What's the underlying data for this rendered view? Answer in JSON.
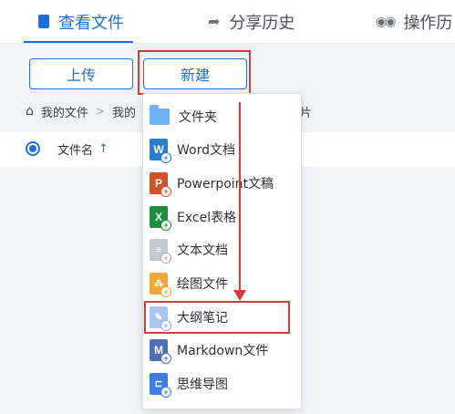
{
  "tabs": [
    {
      "label": "查看文件",
      "icon": "document-icon",
      "active": true
    },
    {
      "label": "分享历史",
      "icon": "share-icon",
      "active": false
    },
    {
      "label": "操作历",
      "icon": "glasses-icon",
      "active": false
    }
  ],
  "toolbar": {
    "upload_label": "上传",
    "new_label": "新建"
  },
  "breadcrumb": {
    "home_icon": "home-icon",
    "items": [
      "我的文件",
      "我的",
      "片"
    ]
  },
  "list": {
    "name_column": "文件名",
    "sort_arrow": "↑"
  },
  "new_menu": {
    "items": [
      {
        "label": "文件夹",
        "icon": "folder-icon",
        "color": "#6fb3f5",
        "letter": ""
      },
      {
        "label": "Word文档",
        "icon": "word-icon",
        "color": "#2b7cd3",
        "letter": "W"
      },
      {
        "label": "Powerpoint文稿",
        "icon": "powerpoint-icon",
        "color": "#d0522a",
        "letter": "P"
      },
      {
        "label": "Excel表格",
        "icon": "excel-icon",
        "color": "#1e8e3e",
        "letter": "X"
      },
      {
        "label": "文本文档",
        "icon": "text-file-icon",
        "color": "#c4c8cf",
        "letter": ""
      },
      {
        "label": "绘图文件",
        "icon": "drawing-icon",
        "color": "#f3a73a",
        "letter": ""
      },
      {
        "label": "大纲笔记",
        "icon": "outline-note-icon",
        "color": "#a9c6f0",
        "letter": ""
      },
      {
        "label": "Markdown文件",
        "icon": "markdown-icon",
        "color": "#4f6fb8",
        "letter": "M"
      },
      {
        "label": "思维导图",
        "icon": "mindmap-icon",
        "color": "#3f7be6",
        "letter": ""
      }
    ]
  },
  "colors": {
    "accent": "#1f6fd6",
    "highlight": "#d43b3b"
  }
}
